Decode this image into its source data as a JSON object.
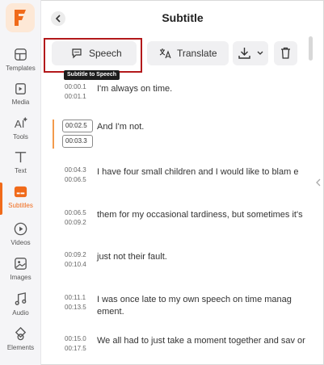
{
  "app": {
    "brand_color": "#f06a1a"
  },
  "sidebar": {
    "items": [
      {
        "label": "Templates",
        "icon": "templates-icon"
      },
      {
        "label": "Media",
        "icon": "media-icon"
      },
      {
        "label": "Tools",
        "icon": "ai-tools-icon"
      },
      {
        "label": "Text",
        "icon": "text-icon"
      },
      {
        "label": "Subtitles",
        "icon": "subtitles-icon",
        "active": true
      },
      {
        "label": "Videos",
        "icon": "videos-icon"
      },
      {
        "label": "Images",
        "icon": "images-icon"
      },
      {
        "label": "Audio",
        "icon": "audio-icon"
      },
      {
        "label": "Elements",
        "icon": "elements-icon"
      }
    ]
  },
  "header": {
    "title": "Subtitle"
  },
  "toolbar": {
    "speech_label": "Speech",
    "translate_label": "Translate",
    "tooltip": "Subtitle to Speech"
  },
  "subtitles": [
    {
      "start": "00:00.1",
      "end": "00:01.1",
      "text": "I'm always on time."
    },
    {
      "start": "00:02.5",
      "end": "00:03.3",
      "text": "And I'm not.",
      "active": true
    },
    {
      "start": "00:04.3",
      "end": "00:06.5",
      "text": "I have four small children and I would like to blam e"
    },
    {
      "start": "00:06.5",
      "end": "00:09.2",
      "text": "them for my occasional tardiness, but sometimes it's"
    },
    {
      "start": "00:09.2",
      "end": "00:10.4",
      "text": "just not their fault."
    },
    {
      "start": "00:11.1",
      "end": "00:13.5",
      "text": "I was once late to my own speech on time manag ement."
    },
    {
      "start": "00:15.0",
      "end": "00:17.5",
      "text": "We all had to just take a moment together and sav or"
    }
  ]
}
